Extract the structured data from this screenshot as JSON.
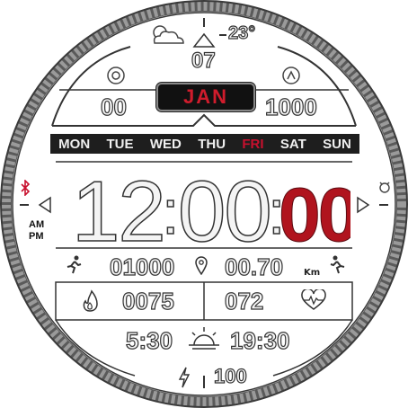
{
  "weather": {
    "icon": "partly-cloudy-icon",
    "temperature": "23°"
  },
  "date": {
    "day": "07",
    "month": "JAN"
  },
  "steps_goal": {
    "current": "00",
    "goal": "1000"
  },
  "weekdays": [
    "MON",
    "TUE",
    "WED",
    "THU",
    "FRI",
    "SAT",
    "SUN"
  ],
  "active_weekday_index": 4,
  "time": {
    "hours": "12",
    "minutes": "00",
    "seconds": "00",
    "am": "AM",
    "pm": "PM"
  },
  "activity": {
    "steps": "01000",
    "distance": "00.70",
    "distance_unit": "Km"
  },
  "health": {
    "calories": "0075",
    "heart_rate": "072"
  },
  "sun": {
    "sunrise": "5:30",
    "sunset": "19:30"
  },
  "battery": {
    "level": "100"
  },
  "colors": {
    "accent": "#c8102e",
    "bar": "#1e1e1e",
    "outline": "#2a2a2a"
  }
}
